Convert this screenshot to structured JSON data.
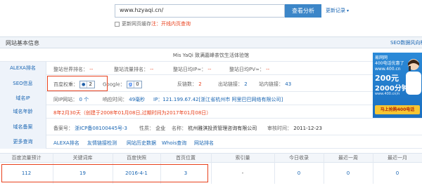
{
  "search": {
    "value": "www.hzyaqi.cn/",
    "button": "查看分析",
    "history": "更新记录",
    "update_label": "更新网页缓存",
    "update_note": "注：开线内页查询"
  },
  "panel": {
    "title": "网站基本信息",
    "seo_link": "SEO数据风向标"
  },
  "site_title": "Mis YaQi 致满嘉峰茶饮生活体验馆",
  "rows": {
    "alexa": {
      "label": "ALEXA排名",
      "world_label": "整站世界排名：",
      "world_val": "--",
      "traffic_label": "整站流量排名：",
      "traffic_val": "--",
      "ip_label": "整站日均IP≈：",
      "ip_val": "--",
      "pv_label": "整站日均PV≈：",
      "pv_val": "--"
    },
    "seo": {
      "label": "SEO信息",
      "baidu_label": "百度权重：",
      "baidu_val": "2",
      "google_label": "Google：",
      "google_val": "0",
      "backlinks_label": "反链数：",
      "backlinks_val": "2",
      "out_label": "出站链接：",
      "out_val": "2",
      "in_label": "站内链接：",
      "in_val": "43"
    },
    "domain_ip": {
      "label": "域名IP",
      "similar_label": "同IP网站：",
      "similar_val": "0 个",
      "speed_label": "响应时间：",
      "speed_val": "49毫秒",
      "ip_text": "IP：121.199.67.42[浙江省杭州市 阿里巴巴网络有限公司]"
    },
    "domain_age": {
      "label": "域名年龄",
      "text": "8年2月30天（创建于2008年01月08日,过期时间为2017年01月08日）"
    },
    "record": {
      "label": "域名备案",
      "no_label": "备案号：",
      "no_val": "浙ICP备08100445号-3",
      "nature_label": "性质：",
      "nature_val": "企业",
      "name_label": "名称：",
      "name_val": "杭州雅淇投资管理咨询有限公司",
      "date_label": "审核时间：",
      "date_val": "2011-12-23"
    },
    "more": {
      "label": "更多查询",
      "links": [
        "ALEXA排名",
        "友情链接检测",
        "网站历史数据",
        "Whois查询",
        "网站排名"
      ]
    }
  },
  "stats": {
    "headers": [
      "百度流量预计",
      "关键词库",
      "百度快照",
      "首页位置",
      "索引量",
      "今日收录",
      "最近一周",
      "最近一月"
    ],
    "values": [
      "112",
      "19",
      "2016-4-1",
      "3",
      "-",
      "0",
      "0",
      "0"
    ]
  },
  "ad": {
    "line1": "易网网",
    "line2": "400电话优惠了",
    "line3": "www.400.cn",
    "price1": "200元",
    "price2": "2000分钟",
    "small": "www.400.cn/n",
    "button": "马上抢购400电话"
  },
  "colors": {
    "accent": "#1a66b3",
    "warn": "#e8401c",
    "button": "#3c86c8"
  }
}
